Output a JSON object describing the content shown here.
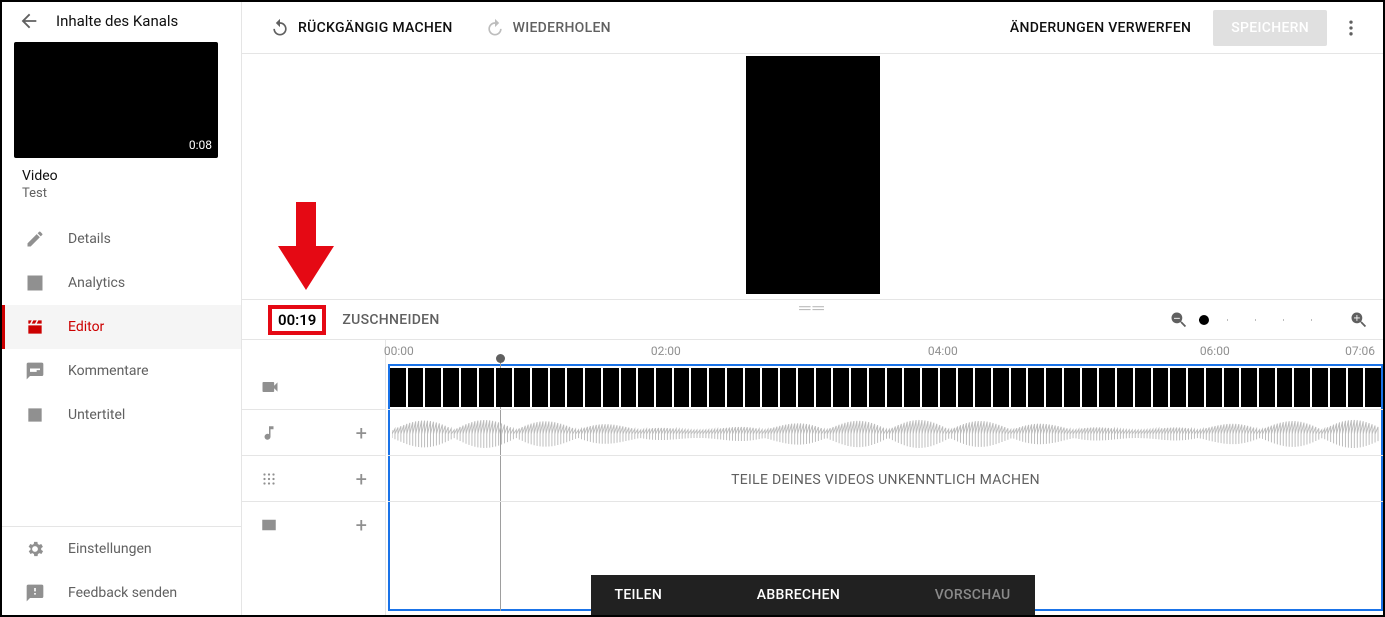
{
  "sidebar": {
    "back_label": "Inhalte des Kanals",
    "thumb_duration": "0:08",
    "video_label": "Video",
    "video_name": "Test",
    "nav": [
      {
        "id": "details",
        "label": "Details"
      },
      {
        "id": "analytics",
        "label": "Analytics"
      },
      {
        "id": "editor",
        "label": "Editor"
      },
      {
        "id": "comments",
        "label": "Kommentare"
      },
      {
        "id": "subtitles",
        "label": "Untertitel"
      }
    ],
    "bottom": [
      {
        "id": "settings",
        "label": "Einstellungen"
      },
      {
        "id": "feedback",
        "label": "Feedback senden"
      }
    ]
  },
  "topbar": {
    "undo": "RÜCKGÄNGIG MACHEN",
    "redo": "WIEDERHOLEN",
    "discard": "ÄNDERUNGEN VERWERFEN",
    "save": "SPEICHERN"
  },
  "editor": {
    "time": "00:19",
    "trim": "ZUSCHNEIDEN",
    "blur_text": "TEILE DEINES VIDEOS UNKENNTLICH MACHEN",
    "ruler": [
      "00:00",
      "02:00",
      "04:00",
      "06:00",
      "07:06"
    ]
  },
  "actionbar": {
    "split": "TEILEN",
    "cancel": "ABBRECHEN",
    "preview": "VORSCHAU"
  }
}
